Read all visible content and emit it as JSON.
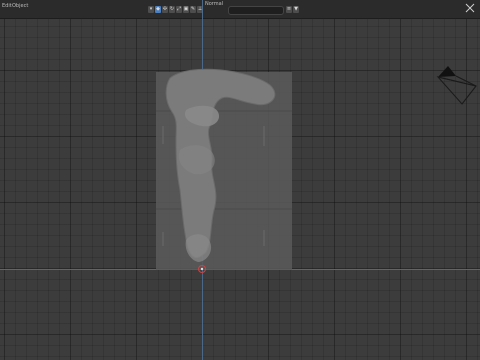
{
  "top_menu": {
    "item1": "Edit",
    "item2": "Object"
  },
  "view": {
    "name": "Normal"
  },
  "tools": {
    "icons": [
      "move-icon",
      "rotate-icon",
      "scale-icon",
      "transform-icon",
      "annotate-icon",
      "measure-icon",
      "add-icon"
    ]
  },
  "colors": {
    "viewport_bg": "#3c3c3c",
    "grid": "#2f2f2f",
    "axis_blue": "#4f6f92",
    "axis_yellow": "#7a6b2f",
    "model_gray": "#7c7c7c",
    "backdrop": "#5a5a5a"
  }
}
